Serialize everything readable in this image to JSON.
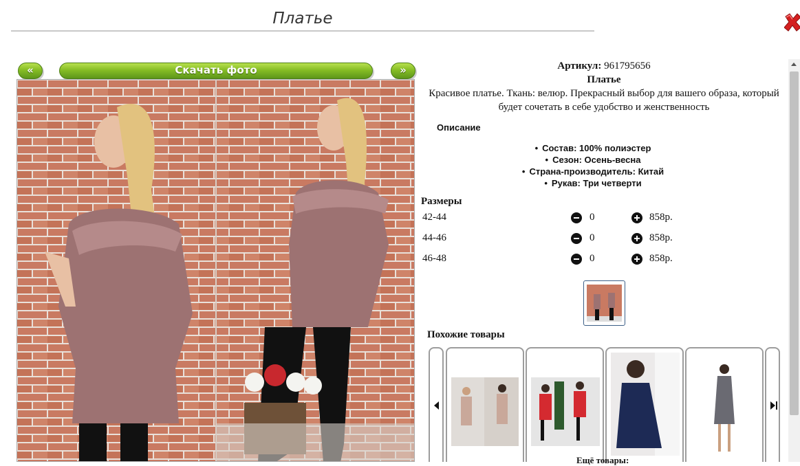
{
  "header": {
    "title": "Платье"
  },
  "buttons": {
    "prev": "«",
    "download": "Скачать фото",
    "next": "»"
  },
  "product": {
    "sku_label": "Артикул:",
    "sku_value": "961795656",
    "name": "Платье",
    "description": "Красивое платье. Ткань: велюр. Прекрасный выбор для вашего образа, который будет сочетать в себе удобство и женственность"
  },
  "details": {
    "heading": "Описание",
    "specs": [
      "Состав: 100% полиэстер",
      "Сезон: Осень-весна",
      "Страна-производитель: Китай",
      "Рукав: Три четверти"
    ]
  },
  "sizes": {
    "heading": "Размеры",
    "rows": [
      {
        "label": "42-44",
        "qty": "0",
        "price": "858р."
      },
      {
        "label": "44-46",
        "qty": "0",
        "price": "858р."
      },
      {
        "label": "46-48",
        "qty": "0",
        "price": "858р."
      }
    ]
  },
  "similar": {
    "heading": "Похожие товары"
  },
  "footer_cut": "Ещё товары:",
  "colors": {
    "green_button": "#86bd25",
    "close_red": "#d42020",
    "brick": "#c97a62",
    "dress_mauve": "#9d7272"
  },
  "icons": [
    "close-icon",
    "minus-icon",
    "plus-icon",
    "prev-icon",
    "next-icon"
  ]
}
